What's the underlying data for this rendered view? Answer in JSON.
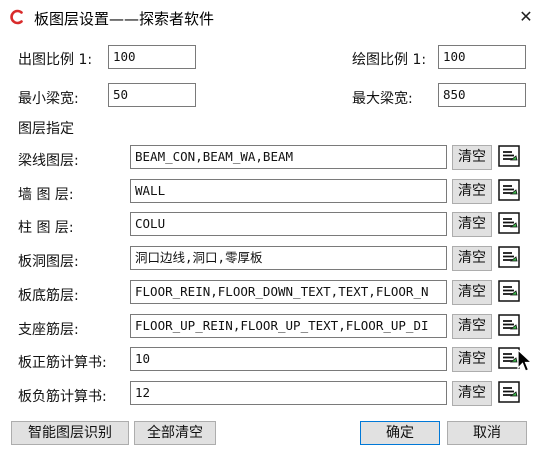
{
  "window": {
    "title": "板图层设置——探索者软件",
    "close_glyph": "✕"
  },
  "scales": {
    "output_label": "出图比例 1:",
    "output_value": "100",
    "draw_label": "绘图比例 1:",
    "draw_value": "100"
  },
  "beam_width": {
    "min_label": "最小梁宽:",
    "min_value": "50",
    "max_label": "最大梁宽:",
    "max_value": "850"
  },
  "section_title": "图层指定",
  "layers": [
    {
      "label": "梁线图层:",
      "value": "BEAM_CON,BEAM_WA,BEAM"
    },
    {
      "label": "墙 图 层:",
      "value": "WALL"
    },
    {
      "label": "柱 图 层:",
      "value": "COLU"
    },
    {
      "label": "板洞图层:",
      "value": "洞口边线,洞口,零厚板"
    },
    {
      "label": "板底筋层:",
      "value": "FLOOR_REIN,FLOOR_DOWN_TEXT,TEXT,FLOOR_N"
    },
    {
      "label": "支座筋层:",
      "value": "FLOOR_UP_REIN,FLOOR_UP_TEXT,FLOOR_UP_DI"
    },
    {
      "label": "板正筋计算书:",
      "value": "10"
    },
    {
      "label": "板负筋计算书:",
      "value": "12"
    }
  ],
  "clear_label": "清空",
  "icons": {
    "app": "app-logo-icon",
    "picker": "layer-pick-icon"
  },
  "colors": {
    "primary_border": "#0078d7",
    "button_bg": "#e1e1e1"
  },
  "footer": {
    "smart_identify": "智能图层识别",
    "clear_all": "全部清空",
    "ok": "确定",
    "cancel": "取消"
  }
}
